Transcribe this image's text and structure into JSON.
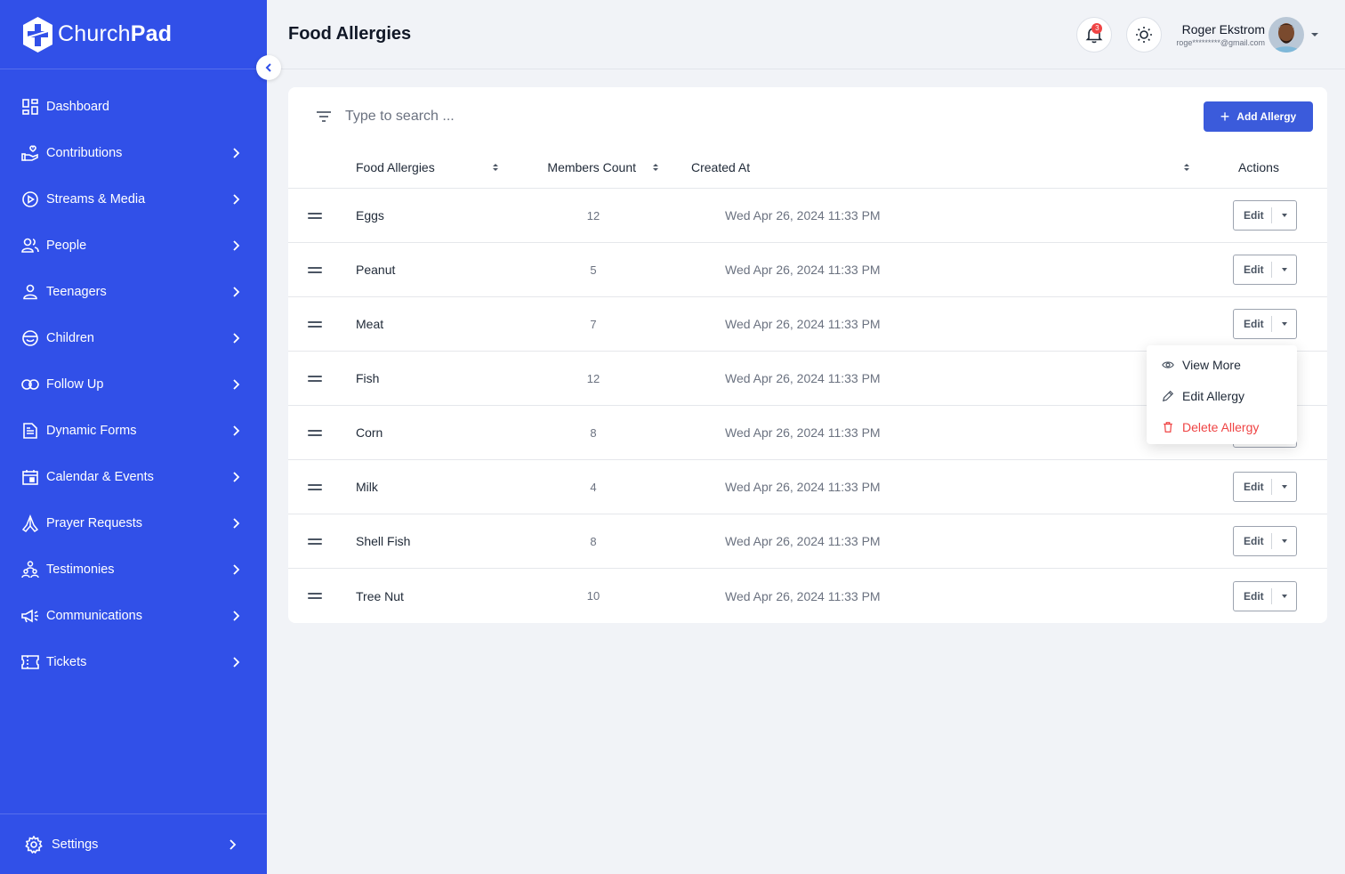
{
  "brand": {
    "name_light": "Church",
    "name_bold": "Pad"
  },
  "sidebar": {
    "items": [
      {
        "label": "Dashboard",
        "icon": "grid-icon",
        "has_chevron": false
      },
      {
        "label": "Contributions",
        "icon": "hand-heart-icon",
        "has_chevron": true
      },
      {
        "label": "Streams & Media",
        "icon": "play-circle-icon",
        "has_chevron": true
      },
      {
        "label": "People",
        "icon": "users-icon",
        "has_chevron": true
      },
      {
        "label": "Teenagers",
        "icon": "user-icon",
        "has_chevron": true
      },
      {
        "label": "Children",
        "icon": "smile-icon",
        "has_chevron": true
      },
      {
        "label": "Follow Up",
        "icon": "link-icon",
        "has_chevron": true
      },
      {
        "label": "Dynamic Forms",
        "icon": "document-icon",
        "has_chevron": true
      },
      {
        "label": "Calendar & Events",
        "icon": "calendar-icon",
        "has_chevron": true
      },
      {
        "label": "Prayer Requests",
        "icon": "praying-hands-icon",
        "has_chevron": true
      },
      {
        "label": "Testimonies",
        "icon": "people-group-icon",
        "has_chevron": true
      },
      {
        "label": "Communications",
        "icon": "megaphone-icon",
        "has_chevron": true
      },
      {
        "label": "Tickets",
        "icon": "ticket-icon",
        "has_chevron": true
      }
    ],
    "settings_label": "Settings"
  },
  "header": {
    "title": "Food Allergies",
    "notification_count": "3",
    "user_name": "Roger Ekstrom",
    "user_email": "roge*********@gmail.com"
  },
  "toolbar": {
    "search_placeholder": "Type to search ...",
    "add_label": "Add Allergy"
  },
  "table": {
    "columns": [
      "Food Allergies",
      "Members Count",
      "Created At",
      "Actions"
    ],
    "edit_label": "Edit",
    "rows": [
      {
        "name": "Eggs",
        "count": "12",
        "created": "Wed Apr 26, 2024 11:33 PM"
      },
      {
        "name": "Peanut",
        "count": "5",
        "created": "Wed Apr 26, 2024 11:33 PM"
      },
      {
        "name": "Meat",
        "count": "7",
        "created": "Wed Apr 26, 2024 11:33 PM"
      },
      {
        "name": "Fish",
        "count": "12",
        "created": "Wed Apr 26, 2024 11:33 PM"
      },
      {
        "name": "Corn",
        "count": "8",
        "created": "Wed Apr 26, 2024 11:33 PM"
      },
      {
        "name": "Milk",
        "count": "4",
        "created": "Wed Apr 26, 2024 11:33 PM"
      },
      {
        "name": "Shell Fish",
        "count": "8",
        "created": "Wed Apr 26, 2024 11:33 PM"
      },
      {
        "name": "Tree Nut",
        "count": "10",
        "created": "Wed Apr 26, 2024 11:33 PM"
      }
    ]
  },
  "dropdown_menu": {
    "items": [
      {
        "label": "View More",
        "icon": "eye-icon"
      },
      {
        "label": "Edit Allergy",
        "icon": "pencil-icon"
      },
      {
        "label": "Delete Allergy",
        "icon": "trash-icon"
      }
    ]
  },
  "colors": {
    "sidebar": "#3150E8",
    "primary_button": "#3B5BDB",
    "danger": "#EF4444",
    "background": "#F1F3F7"
  }
}
